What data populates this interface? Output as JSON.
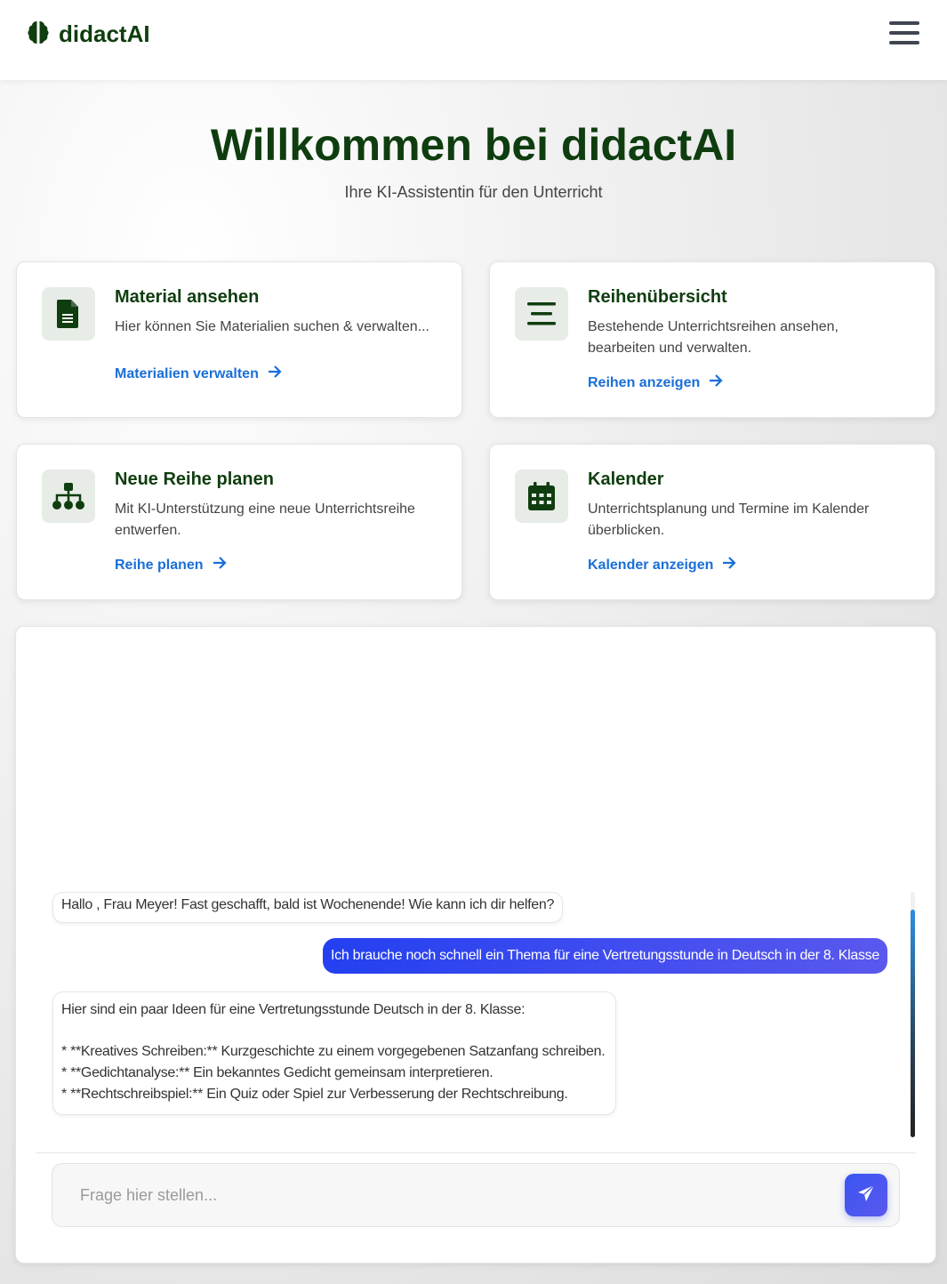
{
  "brand": {
    "name": "didactAI",
    "icon": "brain-icon"
  },
  "header": {
    "menu_icon": "hamburger-menu-icon"
  },
  "hero": {
    "title": "Willkommen bei didactAI",
    "subtitle": "Ihre KI-Assistentin für den Unterricht"
  },
  "colors": {
    "brand_green": "#0f3d0f",
    "link_blue": "#1a6fd8",
    "user_bubble": "#2340f0"
  },
  "cards": [
    {
      "icon": "document-icon",
      "title": "Material ansehen",
      "description": "Hier können Sie Materialien suchen & verwalten...",
      "link": "Materialien verwalten"
    },
    {
      "icon": "list-lines-icon",
      "title": "Reihenübersicht",
      "description": "Bestehende Unterrichtsreihen ansehen, bearbeiten und verwalten.",
      "link": "Reihen anzeigen"
    },
    {
      "icon": "sitemap-icon",
      "title": "Neue Reihe planen",
      "description": "Mit KI-Unterstützung eine neue Unterrichtsreihe entwerfen.",
      "link": "Reihe planen"
    },
    {
      "icon": "calendar-icon",
      "title": "Kalender",
      "description": "Unterrichtsplanung und Termine im Kalender überblicken.",
      "link": "Kalender anzeigen"
    }
  ],
  "chat": {
    "messages": [
      {
        "role": "assistant",
        "text": "Hallo , Frau Meyer! Fast geschafft, bald ist Wochenende! Wie kann ich dir helfen?"
      },
      {
        "role": "user",
        "text": "Ich brauche noch schnell ein Thema für eine Vertretungsstunde in Deutsch in der 8. Klasse"
      },
      {
        "role": "assistant",
        "lines": [
          "Hier sind ein paar Ideen für eine Vertretungsstunde Deutsch in der 8. Klasse:",
          "* **Kreatives Schreiben:** Kurzgeschichte zu einem vorgegebenen Satzanfang schreiben.",
          "* **Gedichtanalyse:** Ein bekanntes Gedicht gemeinsam interpretieren.",
          "* **Rechtschreibspiel:** Ein Quiz oder Spiel zur Verbesserung der Rechtschreibung."
        ]
      }
    ],
    "input_placeholder": "Frage hier stellen...",
    "input_value": "",
    "send_icon": "paper-plane-icon"
  }
}
